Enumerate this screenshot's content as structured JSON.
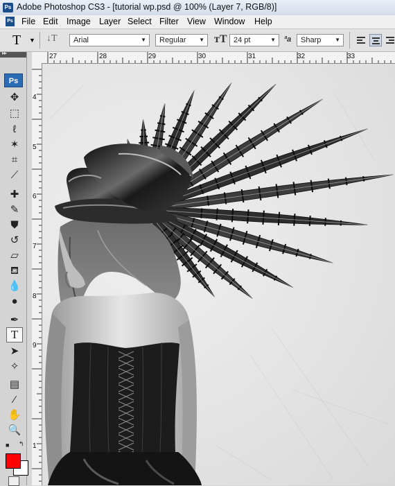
{
  "window": {
    "title": "Adobe Photoshop CS3 - [tutorial wp.psd @ 100% (Layer 7, RGB/8)]",
    "app_badge": "Ps"
  },
  "menu": {
    "items": [
      "File",
      "Edit",
      "Image",
      "Layer",
      "Select",
      "Filter",
      "View",
      "Window",
      "Help"
    ]
  },
  "options_bar": {
    "tool_icon": "T",
    "font_family": "Arial",
    "font_style": "Regular",
    "font_size": "24 pt",
    "antialias": "Sharp"
  },
  "tools_panel": {
    "badge": "Ps",
    "header_glyph": "▸▸"
  },
  "rulers": {
    "top": [
      "27",
      "28",
      "29",
      "30",
      "31",
      "32",
      "33"
    ],
    "left": [
      "4",
      "5",
      "6",
      "7",
      "8",
      "9",
      "1"
    ]
  },
  "colors": {
    "foreground": "#ff0000",
    "background": "#ffffff"
  }
}
